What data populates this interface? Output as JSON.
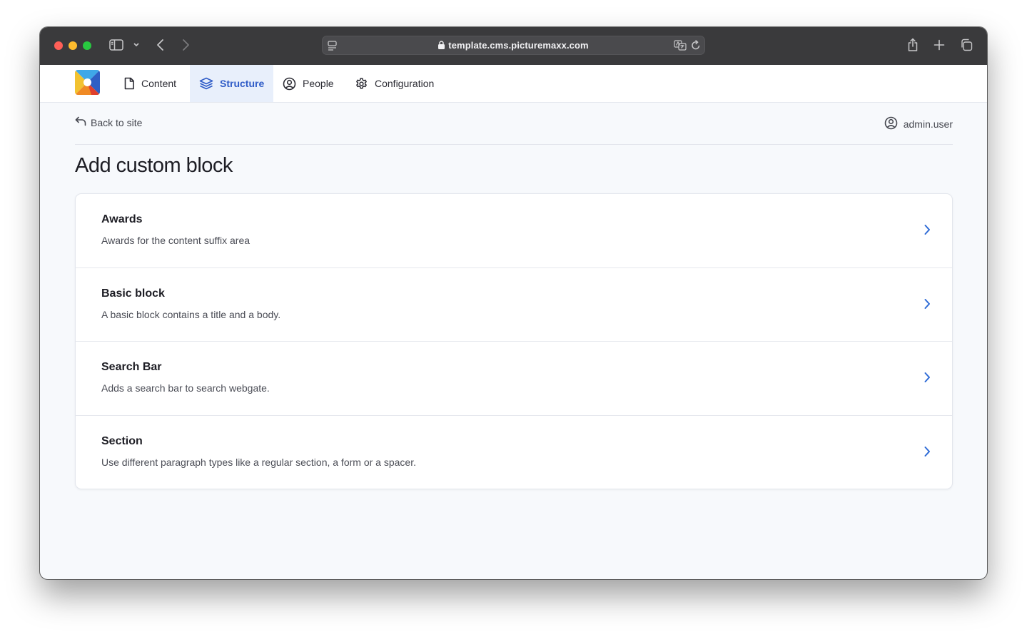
{
  "browser": {
    "url": "template.cms.picturemaxx.com",
    "traffic_colors": {
      "close": "#ff5f57",
      "minimize": "#febc2e",
      "zoom": "#28c840"
    }
  },
  "admin_nav": {
    "items": [
      {
        "label": "Content",
        "icon": "file-icon",
        "active": false
      },
      {
        "label": "Structure",
        "icon": "layers-icon",
        "active": true
      },
      {
        "label": "People",
        "icon": "user-circle-icon",
        "active": false
      },
      {
        "label": "Configuration",
        "icon": "gear-icon",
        "active": false
      }
    ],
    "accent_color": "#2e5bc7"
  },
  "page": {
    "back_label": "Back to site",
    "user_label": "admin.user",
    "title": "Add custom block"
  },
  "blocks": [
    {
      "name": "Awards",
      "description": "Awards for the content suffix area"
    },
    {
      "name": "Basic block",
      "description": "A basic block contains a title and a body."
    },
    {
      "name": "Search Bar",
      "description": "Adds a search bar to search webgate."
    },
    {
      "name": "Section",
      "description": "Use different paragraph types like a regular section, a form or a spacer."
    }
  ]
}
